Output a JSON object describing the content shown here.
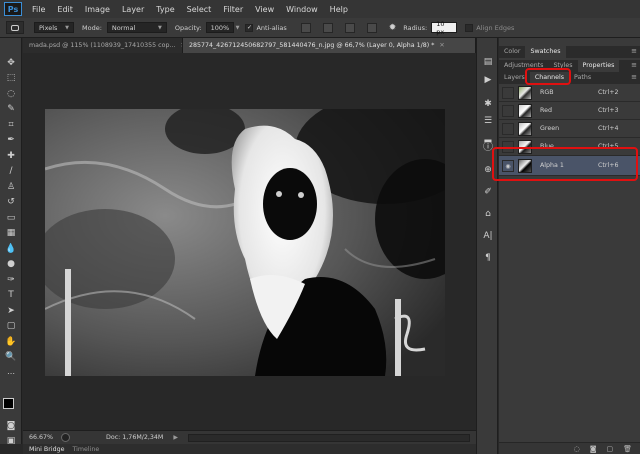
{
  "menubar": {
    "logo": "Ps",
    "items": [
      "File",
      "Edit",
      "Image",
      "Layer",
      "Type",
      "Select",
      "Filter",
      "View",
      "Window",
      "Help"
    ]
  },
  "options": {
    "size_value": "Pixels",
    "mode_label": "Mode:",
    "mode_value": "Normal",
    "opacity_label": "Opacity:",
    "opacity_value": "100%",
    "antialias_label": "Anti-alias",
    "radius_label": "Radius:",
    "radius_value": "10 px",
    "align_edges_label": "Align Edges"
  },
  "doc_tabs": [
    {
      "label": "mada.psd @ 115% (1108939_17410355 cop...",
      "active": false
    },
    {
      "label": "285774_426712450682797_581440476_n.jpg @ 66,7% (Layer 0, Alpha 1/8) *",
      "active": true
    }
  ],
  "status": {
    "zoom": "66.67%",
    "doc_info": "Doc: 1,76M/2,34M"
  },
  "bottom_tabs": [
    "Mini Bridge",
    "Timeline"
  ],
  "panels": {
    "top_tabs": [
      "Color",
      "Swatches"
    ],
    "mid_tabs": [
      "Adjustments",
      "Styles",
      "Properties"
    ],
    "channel_tabs": [
      "Layers",
      "Channels",
      "Paths"
    ],
    "channels": [
      {
        "name": "RGB",
        "shortcut": "Ctrl+2",
        "visible": false,
        "selected": false
      },
      {
        "name": "Red",
        "shortcut": "Ctrl+3",
        "visible": false,
        "selected": false
      },
      {
        "name": "Green",
        "shortcut": "Ctrl+4",
        "visible": false,
        "selected": false
      },
      {
        "name": "Blue",
        "shortcut": "Ctrl+5",
        "visible": false,
        "selected": false
      },
      {
        "name": "Alpha 1",
        "shortcut": "Ctrl+6",
        "visible": true,
        "selected": true
      }
    ]
  },
  "colors": {
    "highlight_ring": "#e01010",
    "selected_row": "#4a5468",
    "accent_blue": "#3b8ed6"
  }
}
